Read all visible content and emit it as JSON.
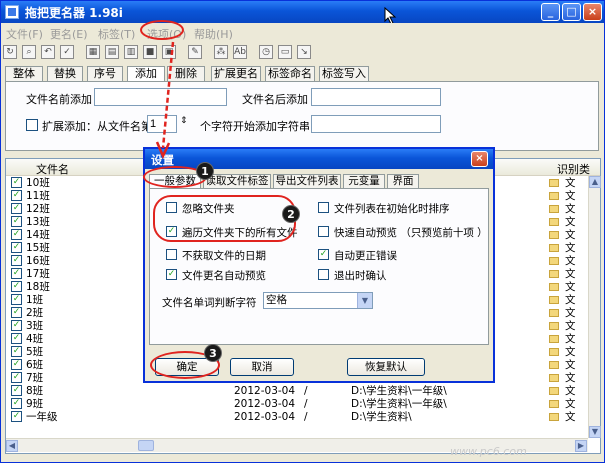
{
  "window": {
    "title": "拖把更名器 1.98i",
    "min_label": "_",
    "max_label": "□",
    "close_label": "×"
  },
  "menu": [
    {
      "label": "文件(F)"
    },
    {
      "label": "更名(E)"
    },
    {
      "label": "标签(T)"
    },
    {
      "label": "选项(O)"
    },
    {
      "label": "帮助(H)"
    }
  ],
  "toolbar_glyphs": [
    "↻",
    "⌕",
    "↶",
    "✓",
    "▦",
    "▤",
    "▥",
    "■",
    "▣",
    "✎",
    "⁂",
    "Ab",
    "◷",
    "▭",
    "↘"
  ],
  "tabs": [
    {
      "label": "整体"
    },
    {
      "label": "替换"
    },
    {
      "label": "序号"
    },
    {
      "label": "添加"
    },
    {
      "label": "删除"
    },
    {
      "label": "扩展更名"
    },
    {
      "label": "标签命名"
    },
    {
      "label": "标签写入"
    }
  ],
  "add_panel": {
    "prefix_label": "文件名前添加",
    "prefix_value": "",
    "suffix_label": "文件名后添加",
    "suffix_value": "",
    "extend_label": "扩展添加：从文件名第",
    "extend_value": "1",
    "extend_tail": "个字符开始添加字符串",
    "extend_text": ""
  },
  "list": {
    "col_name": "文件名",
    "col_type": "识别类",
    "rows": [
      {
        "name": "10班",
        "date": "",
        "slash": "",
        "path": "",
        "type": "文"
      },
      {
        "name": "11班",
        "date": "",
        "slash": "",
        "path": "",
        "type": "文"
      },
      {
        "name": "12班",
        "date": "",
        "slash": "",
        "path": "",
        "type": "文"
      },
      {
        "name": "13班",
        "date": "",
        "slash": "",
        "path": "",
        "type": "文"
      },
      {
        "name": "14班",
        "date": "",
        "slash": "",
        "path": "",
        "type": "文"
      },
      {
        "name": "15班",
        "date": "",
        "slash": "",
        "path": "",
        "type": "文"
      },
      {
        "name": "16班",
        "date": "",
        "slash": "",
        "path": "",
        "type": "文"
      },
      {
        "name": "17班",
        "date": "",
        "slash": "",
        "path": "",
        "type": "文"
      },
      {
        "name": "18班",
        "date": "",
        "slash": "",
        "path": "",
        "type": "文"
      },
      {
        "name": "1班",
        "date": "",
        "slash": "",
        "path": "",
        "type": "文"
      },
      {
        "name": "2班",
        "date": "",
        "slash": "",
        "path": "",
        "type": "文"
      },
      {
        "name": "3班",
        "date": "",
        "slash": "",
        "path": "",
        "type": "文"
      },
      {
        "name": "4班",
        "date": "",
        "slash": "",
        "path": "",
        "type": "文"
      },
      {
        "name": "5班",
        "date": "",
        "slash": "",
        "path": "",
        "type": "文"
      },
      {
        "name": "6班",
        "date": "",
        "slash": "",
        "path": "",
        "type": "文"
      },
      {
        "name": "7班",
        "date": "2012-03-04",
        "slash": "/",
        "path": "D:\\学生资料\\一年级\\",
        "type": "文"
      },
      {
        "name": "8班",
        "date": "2012-03-04",
        "slash": "/",
        "path": "D:\\学生资料\\一年级\\",
        "type": "文"
      },
      {
        "name": "9班",
        "date": "2012-03-04",
        "slash": "/",
        "path": "D:\\学生资料\\一年级\\",
        "type": "文"
      },
      {
        "name": "一年级",
        "date": "2012-03-04",
        "slash": "/",
        "path": "D:\\学生资料\\",
        "type": "文"
      }
    ]
  },
  "dialog": {
    "title": "设置",
    "close_label": "×",
    "tabs": [
      {
        "label": "一般参数"
      },
      {
        "label": "读取文件标签"
      },
      {
        "label": "导出文件列表"
      },
      {
        "label": "元变量"
      },
      {
        "label": "界面"
      }
    ],
    "options": [
      {
        "label": "忽略文件夹",
        "checked": false
      },
      {
        "label": "遍历文件夹下的所有文件",
        "checked": true
      },
      {
        "label": "不获取文件的日期",
        "checked": false
      },
      {
        "label": "文件更名自动预览",
        "checked": true
      },
      {
        "label": "文件列表在初始化时排序",
        "checked": false
      },
      {
        "label": "快速自动预览 （只预览前十项 ）",
        "checked": false
      },
      {
        "label": "自动更正错误",
        "checked": true
      },
      {
        "label": "退出时确认",
        "checked": false
      }
    ],
    "separator_label": "文件名单词判断字符",
    "separator_value": "空格",
    "ok_label": "确定",
    "cancel_label": "取消",
    "reset_label": "恢复默认"
  },
  "annotations": {
    "badge1": "1",
    "badge2": "2",
    "badge3": "3",
    "accent": "#e0241f"
  },
  "watermark": "www.pc6.com"
}
